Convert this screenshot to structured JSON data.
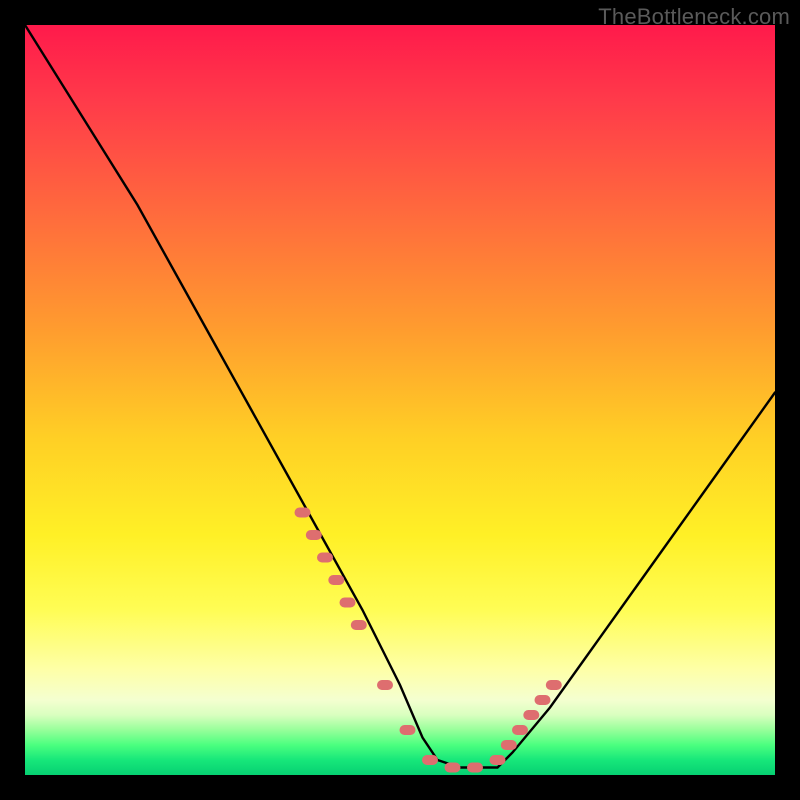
{
  "watermark": "TheBottleneck.com",
  "chart_data": {
    "type": "line",
    "title": "",
    "xlabel": "",
    "ylabel": "",
    "xlim": [
      0,
      100
    ],
    "ylim": [
      0,
      100
    ],
    "grid": false,
    "series": [
      {
        "name": "curve",
        "x": [
          0,
          5,
          10,
          15,
          20,
          25,
          30,
          35,
          40,
          45,
          50,
          53,
          55,
          58,
          60,
          63,
          65,
          70,
          75,
          80,
          85,
          90,
          95,
          100
        ],
        "values": [
          100,
          92,
          84,
          76,
          67,
          58,
          49,
          40,
          31,
          22,
          12,
          5,
          2,
          1,
          1,
          1,
          3,
          9,
          16,
          23,
          30,
          37,
          44,
          51
        ]
      }
    ],
    "markers": {
      "name": "highlight-dots",
      "color": "#de6e6f",
      "x": [
        37,
        38.5,
        40,
        41.5,
        43,
        44.5,
        48,
        51,
        54,
        57,
        60,
        63,
        64.5,
        66,
        67.5,
        69,
        70.5
      ],
      "values": [
        35,
        32,
        29,
        26,
        23,
        20,
        12,
        6,
        2,
        1,
        1,
        2,
        4,
        6,
        8,
        10,
        12
      ]
    }
  }
}
